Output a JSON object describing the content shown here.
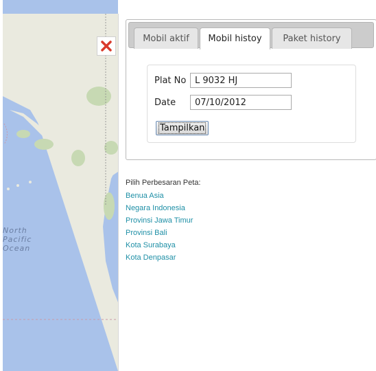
{
  "map": {
    "ocean_label": [
      "North",
      "Pacific",
      "Ocean"
    ],
    "close_icon": "close-x-icon",
    "colors": {
      "ocean": "#a9c2ea",
      "land": "#eaeadf",
      "forest": "#c7d9b3",
      "close": "#d93a2b"
    }
  },
  "tabs": [
    {
      "label": "Mobil aktif",
      "active": false
    },
    {
      "label": "Mobil histoy",
      "active": true
    },
    {
      "label": "Paket history",
      "active": false
    }
  ],
  "form": {
    "plat_label": "Plat No",
    "plat_value": "L 9032 HJ",
    "date_label": "Date",
    "date_value": "07/10/2012",
    "submit_label": "Tampilkan"
  },
  "zoom": {
    "title": "Pilih Perbesaran Peta:",
    "links": [
      "Benua Asia",
      "Negara Indonesia",
      "Provinsi Jawa Timur",
      "Provinsi Bali",
      "Kota Surabaya",
      "Kota Denpasar"
    ],
    "link_color": "#1e8fa6"
  }
}
